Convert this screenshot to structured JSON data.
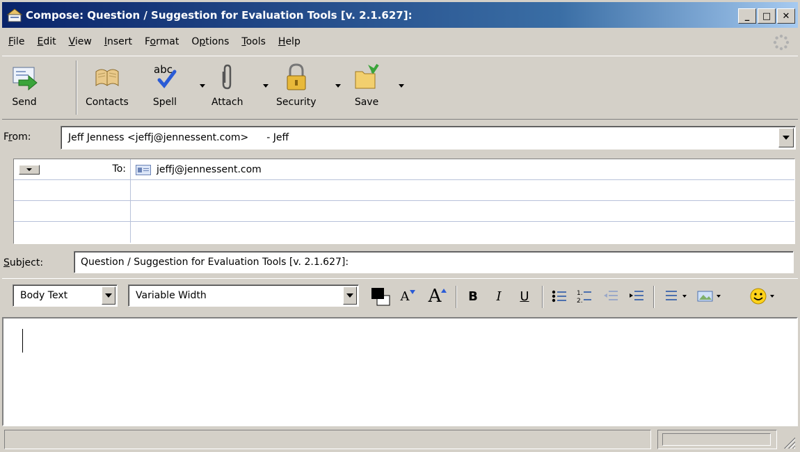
{
  "window": {
    "title": "Compose: Question / Suggestion for Evaluation Tools [v. 2.1.627]:",
    "controls": {
      "minimize": "_",
      "maximize": "□",
      "close": "✕"
    }
  },
  "menu": [
    {
      "pre": "",
      "mn": "F",
      "post": "ile"
    },
    {
      "pre": "",
      "mn": "E",
      "post": "dit"
    },
    {
      "pre": "",
      "mn": "V",
      "post": "iew"
    },
    {
      "pre": "",
      "mn": "I",
      "post": "nsert"
    },
    {
      "pre": "F",
      "mn": "o",
      "post": "rmat"
    },
    {
      "pre": "O",
      "mn": "p",
      "post": "tions"
    },
    {
      "pre": "",
      "mn": "T",
      "post": "ools"
    },
    {
      "pre": "",
      "mn": "H",
      "post": "elp"
    }
  ],
  "toolbar": {
    "send": "Send",
    "contacts": "Contacts",
    "spell": "Spell",
    "spell_icon_text": "abc",
    "attach": "Attach",
    "security": "Security",
    "save": "Save"
  },
  "from": {
    "label_pre": "F",
    "label_mn": "r",
    "label_post": "om:",
    "value": "Jeff Jenness <jeffj@jennessent.com>",
    "alias": "- Jeff"
  },
  "recipients": [
    {
      "type": "To:",
      "address": "jeffj@jennessent.com"
    },
    {
      "type": "",
      "address": ""
    },
    {
      "type": "",
      "address": ""
    },
    {
      "type": "",
      "address": ""
    }
  ],
  "subject": {
    "label_mn": "S",
    "label_post": "ubject:",
    "value": "Question / Suggestion for Evaluation Tools [v. 2.1.627]:"
  },
  "format": {
    "paragraph_style": "Body Text",
    "font": "Variable Width",
    "bold": "B",
    "italic": "I",
    "underline": "U",
    "smaller": "A",
    "larger": "A"
  },
  "body": {
    "text": ""
  },
  "status": {
    "message": ""
  }
}
